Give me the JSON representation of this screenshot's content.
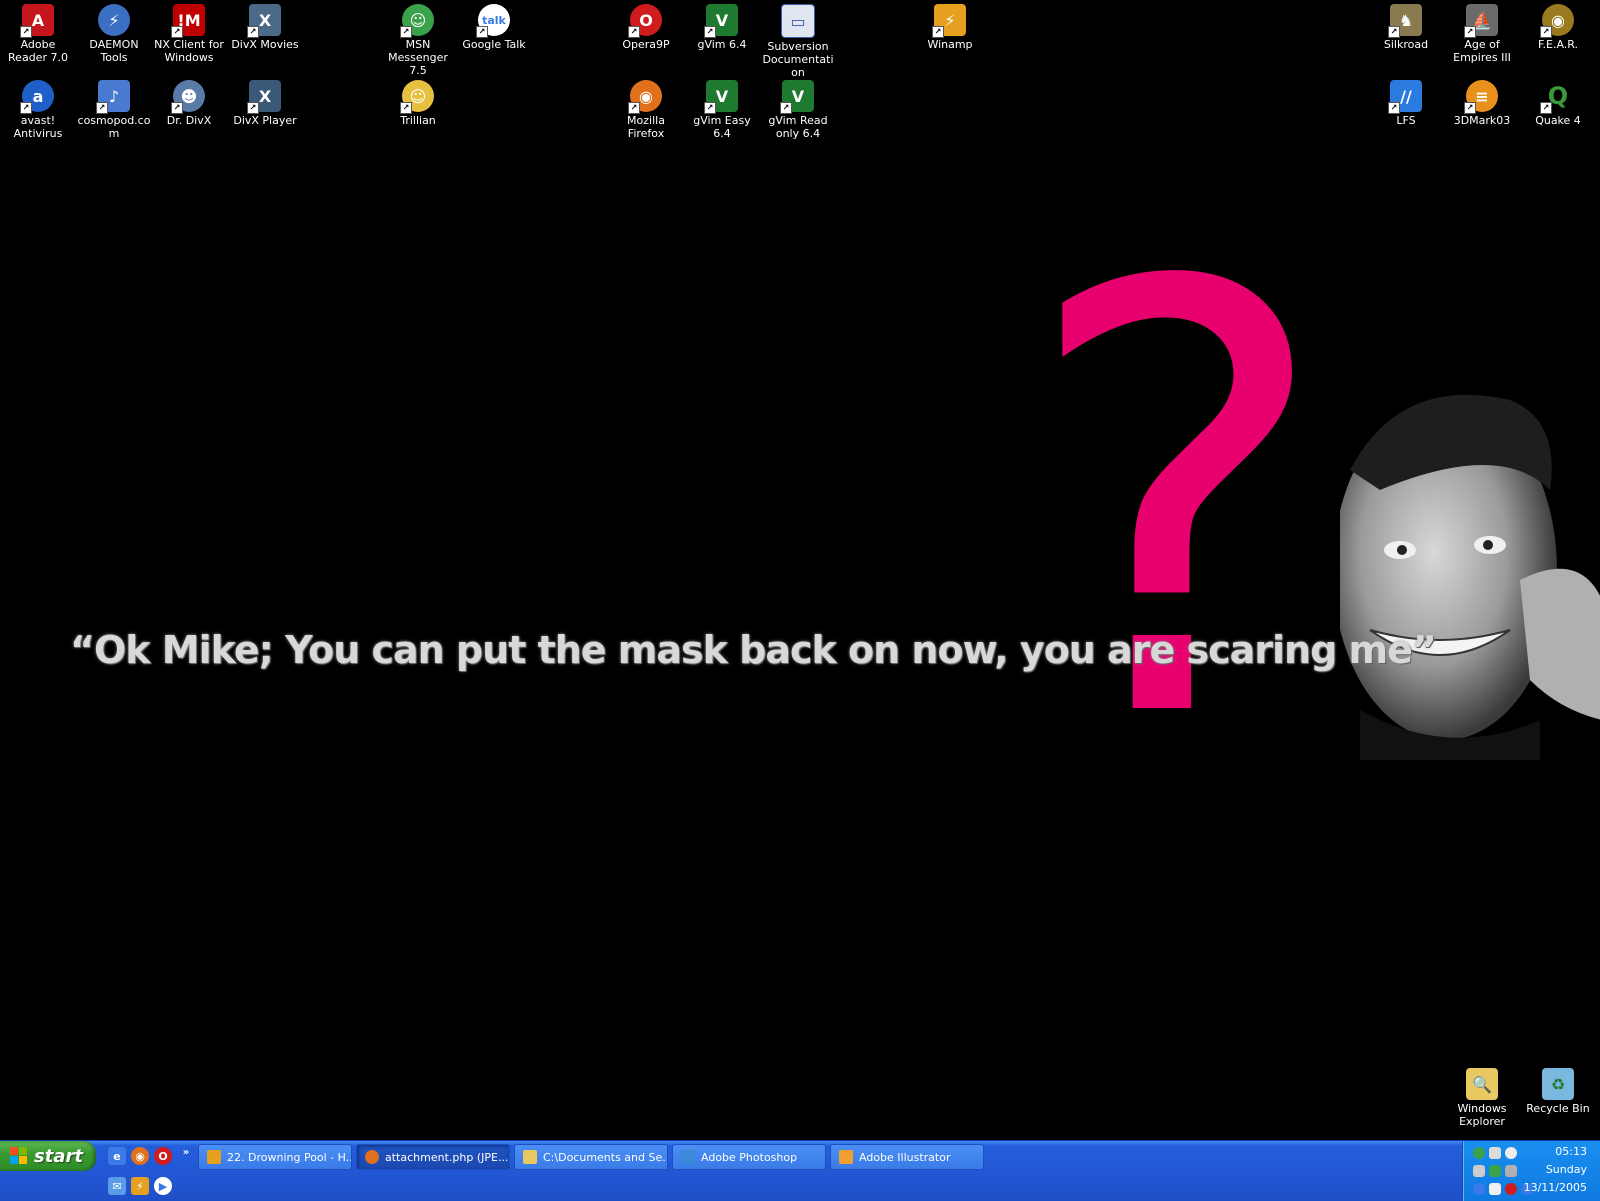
{
  "desktop": {
    "icons": [
      {
        "label": "Adobe Reader 7.0",
        "icon": "adobe-reader-icon",
        "color": "#c4161c"
      },
      {
        "label": "DAEMON Tools",
        "icon": "daemon-tools-icon",
        "color": "#3a6fc4"
      },
      {
        "label": "NX Client for Windows",
        "icon": "nx-client-icon",
        "color": "#c00000"
      },
      {
        "label": "DivX Movies",
        "icon": "divx-movies-icon",
        "color": "#4a6a88"
      },
      {
        "label": "MSN Messenger 7.5",
        "icon": "msn-messenger-icon",
        "color": "#3aa24a"
      },
      {
        "label": "Google Talk",
        "icon": "google-talk-icon",
        "color": "#5a9bd8"
      },
      {
        "label": "Opera9P",
        "icon": "opera-icon",
        "color": "#d01c1c"
      },
      {
        "label": "gVim 6.4",
        "icon": "gvim-icon",
        "color": "#1e7a2e"
      },
      {
        "label": "Subversion Documentation",
        "icon": "subversion-doc-icon",
        "color": "#dfe6f0"
      },
      {
        "label": "Winamp",
        "icon": "winamp-icon",
        "color": "#e6a020"
      },
      {
        "label": "Silkroad",
        "icon": "silkroad-icon",
        "color": "#8a7a50"
      },
      {
        "label": "Age of Empires III",
        "icon": "age-of-empires-icon",
        "color": "#6a6a6a"
      },
      {
        "label": "F.E.A.R.",
        "icon": "fear-icon",
        "color": "#9a7a20"
      },
      {
        "label": "avast! Antivirus",
        "icon": "avast-icon",
        "color": "#1f5fc8"
      },
      {
        "label": "cosmopod.com",
        "icon": "cosmopod-icon",
        "color": "#4a7ad0"
      },
      {
        "label": "Dr. DivX",
        "icon": "dr-divx-icon",
        "color": "#5a7aa8"
      },
      {
        "label": "DivX Player",
        "icon": "divx-player-icon",
        "color": "#3a5a78"
      },
      {
        "label": "Trillian",
        "icon": "trillian-icon",
        "color": "#e8c040"
      },
      {
        "label": "Mozilla Firefox",
        "icon": "firefox-icon",
        "color": "#e0701c"
      },
      {
        "label": "gVim Easy 6.4",
        "icon": "gvim-easy-icon",
        "color": "#1e7a2e"
      },
      {
        "label": "gVim Read only 6.4",
        "icon": "gvim-readonly-icon",
        "color": "#1e7a2e"
      },
      {
        "label": "LFS",
        "icon": "lfs-icon",
        "color": "#2a7ae0"
      },
      {
        "label": "3DMark03",
        "icon": "3dmark-icon",
        "color": "#e8901c"
      },
      {
        "label": "Quake 4",
        "icon": "quake-icon",
        "color": "#3a9a3a"
      },
      {
        "label": "Windows Explorer",
        "icon": "windows-explorer-icon",
        "color": "#e8c860"
      },
      {
        "label": "Recycle Bin",
        "icon": "recycle-bin-icon",
        "color": "#7ab8e0"
      }
    ]
  },
  "wallpaper": {
    "quote": "“Ok Mike; You can put the mask back on now, you are scaring me”",
    "question_mark": "?",
    "accent_color": "#e8006f"
  },
  "taskbar": {
    "start_label": "start",
    "quick_launch": [
      {
        "icon": "internet-explorer-icon",
        "color": "#3a7be8"
      },
      {
        "icon": "firefox-icon",
        "color": "#e0701c"
      },
      {
        "icon": "opera-icon",
        "color": "#d01c1c"
      },
      {
        "icon": "show-more-chevron-icon",
        "color": "#2257d5"
      },
      {
        "icon": "outlook-icon",
        "color": "#5a9be8"
      },
      {
        "icon": "winamp-icon",
        "color": "#e6a020"
      },
      {
        "icon": "media-player-icon",
        "color": "#ffffff"
      }
    ],
    "tasks": [
      {
        "label": "22. Drowning Pool - H...",
        "icon": "winamp-icon",
        "color": "#e6a020",
        "active": false
      },
      {
        "label": "attachment.php (JPE...",
        "icon": "firefox-icon",
        "color": "#e0701c",
        "active": true
      },
      {
        "label": "C:\\Documents and Se...",
        "icon": "folder-icon",
        "color": "#e8c860",
        "active": false
      },
      {
        "label": "Adobe Photoshop",
        "icon": "photoshop-icon",
        "color": "#3a8ad8",
        "active": false
      },
      {
        "label": "Adobe Illustrator",
        "icon": "illustrator-icon",
        "color": "#f0a030",
        "active": false
      }
    ],
    "tray": {
      "icons": [
        {
          "icon": "utorrent-icon",
          "color": "#3aa24a"
        },
        {
          "icon": "msn-tray-icon",
          "color": "#dddddd"
        },
        {
          "icon": "speech-bubble-icon",
          "color": "#eeeeee"
        },
        {
          "icon": "network-icon",
          "color": "#cccccc"
        },
        {
          "icon": "msn-status-icon",
          "color": "#3aa24a"
        },
        {
          "icon": "gaming-icon",
          "color": "#b0b0b0"
        },
        {
          "icon": "info-icon",
          "color": "#3a7be8"
        },
        {
          "icon": "volume-icon",
          "color": "#f0f0f0"
        },
        {
          "icon": "antivirus-tray-icon",
          "color": "#d01c1c"
        },
        {
          "icon": "avast-tray-icon",
          "color": "#3a7be8"
        }
      ],
      "time": "05:13",
      "day": "Sunday",
      "date": "13/11/2005"
    }
  }
}
